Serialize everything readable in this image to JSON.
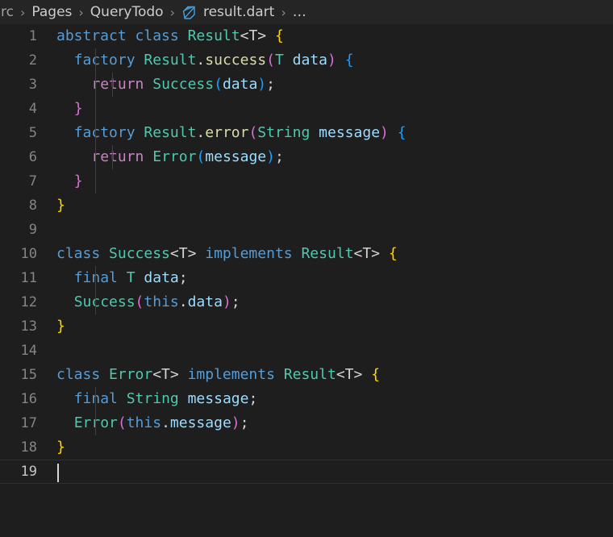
{
  "window": {
    "background": "#1e1e1e",
    "breadcrumb_background": "#252526"
  },
  "breadcrumb": {
    "separator": "›",
    "items": [
      {
        "label": "rc",
        "icon": null
      },
      {
        "label": "Pages",
        "icon": null
      },
      {
        "label": "QueryTodo",
        "icon": null
      },
      {
        "label": "result.dart",
        "icon": "dart-file-icon"
      },
      {
        "label": "…",
        "icon": null
      }
    ]
  },
  "editor": {
    "language": "dart",
    "file_name": "result.dart",
    "cursor_line": 19,
    "cursor_column": 1,
    "line_count": 19,
    "colors": {
      "keyword": "#569cd6",
      "type": "#4ec9b0",
      "control": "#c586c0",
      "function": "#dcdcaa",
      "variable": "#9cdcfe",
      "plain": "#d4d4d4",
      "bracket_yellow": "#ffd700",
      "bracket_violet": "#da70d6",
      "bracket_blue": "#179fff",
      "line_number": "#858585",
      "line_number_active": "#c6c6c6",
      "indent_guide": "#404040",
      "caret": "#d4d4d4"
    },
    "lines": [
      {
        "n": "1",
        "guides": [],
        "text": "abstract class Result<T> {"
      },
      {
        "n": "2",
        "guides": [
          1
        ],
        "text": "  factory Result.success(T data) {"
      },
      {
        "n": "3",
        "guides": [
          1,
          2
        ],
        "text": "    return Success(data);"
      },
      {
        "n": "4",
        "guides": [
          1
        ],
        "text": "  }"
      },
      {
        "n": "5",
        "guides": [
          1
        ],
        "text": "  factory Result.error(String message) {"
      },
      {
        "n": "6",
        "guides": [
          1,
          2
        ],
        "text": "    return Error(message);"
      },
      {
        "n": "7",
        "guides": [
          1
        ],
        "text": "  }"
      },
      {
        "n": "8",
        "guides": [],
        "text": "}"
      },
      {
        "n": "9",
        "guides": [],
        "text": ""
      },
      {
        "n": "10",
        "guides": [],
        "text": "class Success<T> implements Result<T> {"
      },
      {
        "n": "11",
        "guides": [
          1
        ],
        "text": "  final T data;"
      },
      {
        "n": "12",
        "guides": [
          1
        ],
        "text": "  Success(this.data);"
      },
      {
        "n": "13",
        "guides": [],
        "text": "}"
      },
      {
        "n": "14",
        "guides": [],
        "text": ""
      },
      {
        "n": "15",
        "guides": [],
        "text": "class Error<T> implements Result<T> {"
      },
      {
        "n": "16",
        "guides": [
          1
        ],
        "text": "  final String message;"
      },
      {
        "n": "17",
        "guides": [
          1
        ],
        "text": "  Error(this.message);"
      },
      {
        "n": "18",
        "guides": [],
        "text": "}"
      },
      {
        "n": "19",
        "guides": [],
        "text": ""
      }
    ],
    "tokens": [
      [
        {
          "t": "abstract",
          "c": "kw"
        },
        {
          "t": " ",
          "c": "pl"
        },
        {
          "t": "class",
          "c": "kw"
        },
        {
          "t": " ",
          "c": "pl"
        },
        {
          "t": "Result",
          "c": "typ"
        },
        {
          "t": "<T>",
          "c": "pl"
        },
        {
          "t": " ",
          "c": "pl"
        },
        {
          "t": "{",
          "c": "by"
        }
      ],
      [
        {
          "t": "  ",
          "c": "pl"
        },
        {
          "t": "factory",
          "c": "kw"
        },
        {
          "t": " ",
          "c": "pl"
        },
        {
          "t": "Result",
          "c": "typ"
        },
        {
          "t": ".",
          "c": "pl"
        },
        {
          "t": "success",
          "c": "fn"
        },
        {
          "t": "(",
          "c": "bp"
        },
        {
          "t": "T",
          "c": "typ"
        },
        {
          "t": " ",
          "c": "pl"
        },
        {
          "t": "data",
          "c": "var"
        },
        {
          "t": ")",
          "c": "bp"
        },
        {
          "t": " ",
          "c": "pl"
        },
        {
          "t": "{",
          "c": "bb"
        }
      ],
      [
        {
          "t": "    ",
          "c": "pl"
        },
        {
          "t": "return",
          "c": "ctl"
        },
        {
          "t": " ",
          "c": "pl"
        },
        {
          "t": "Success",
          "c": "typ"
        },
        {
          "t": "(",
          "c": "bb"
        },
        {
          "t": "data",
          "c": "var"
        },
        {
          "t": ")",
          "c": "bb"
        },
        {
          "t": ";",
          "c": "pl"
        }
      ],
      [
        {
          "t": "  ",
          "c": "pl"
        },
        {
          "t": "}",
          "c": "bp"
        }
      ],
      [
        {
          "t": "  ",
          "c": "pl"
        },
        {
          "t": "factory",
          "c": "kw"
        },
        {
          "t": " ",
          "c": "pl"
        },
        {
          "t": "Result",
          "c": "typ"
        },
        {
          "t": ".",
          "c": "pl"
        },
        {
          "t": "error",
          "c": "fn"
        },
        {
          "t": "(",
          "c": "bp"
        },
        {
          "t": "String",
          "c": "typ"
        },
        {
          "t": " ",
          "c": "pl"
        },
        {
          "t": "message",
          "c": "var"
        },
        {
          "t": ")",
          "c": "bp"
        },
        {
          "t": " ",
          "c": "pl"
        },
        {
          "t": "{",
          "c": "bb"
        }
      ],
      [
        {
          "t": "    ",
          "c": "pl"
        },
        {
          "t": "return",
          "c": "ctl"
        },
        {
          "t": " ",
          "c": "pl"
        },
        {
          "t": "Error",
          "c": "typ"
        },
        {
          "t": "(",
          "c": "bb"
        },
        {
          "t": "message",
          "c": "var"
        },
        {
          "t": ")",
          "c": "bb"
        },
        {
          "t": ";",
          "c": "pl"
        }
      ],
      [
        {
          "t": "  ",
          "c": "pl"
        },
        {
          "t": "}",
          "c": "bp"
        }
      ],
      [
        {
          "t": "}",
          "c": "by"
        }
      ],
      [],
      [
        {
          "t": "class",
          "c": "kw"
        },
        {
          "t": " ",
          "c": "pl"
        },
        {
          "t": "Success",
          "c": "typ"
        },
        {
          "t": "<T>",
          "c": "pl"
        },
        {
          "t": " ",
          "c": "pl"
        },
        {
          "t": "implements",
          "c": "kw"
        },
        {
          "t": " ",
          "c": "pl"
        },
        {
          "t": "Result",
          "c": "typ"
        },
        {
          "t": "<T>",
          "c": "pl"
        },
        {
          "t": " ",
          "c": "pl"
        },
        {
          "t": "{",
          "c": "by"
        }
      ],
      [
        {
          "t": "  ",
          "c": "pl"
        },
        {
          "t": "final",
          "c": "kw"
        },
        {
          "t": " ",
          "c": "pl"
        },
        {
          "t": "T",
          "c": "typ"
        },
        {
          "t": " ",
          "c": "pl"
        },
        {
          "t": "data",
          "c": "var"
        },
        {
          "t": ";",
          "c": "pl"
        }
      ],
      [
        {
          "t": "  ",
          "c": "pl"
        },
        {
          "t": "Success",
          "c": "typ"
        },
        {
          "t": "(",
          "c": "bp"
        },
        {
          "t": "this",
          "c": "kw"
        },
        {
          "t": ".",
          "c": "pl"
        },
        {
          "t": "data",
          "c": "var"
        },
        {
          "t": ")",
          "c": "bp"
        },
        {
          "t": ";",
          "c": "pl"
        }
      ],
      [
        {
          "t": "}",
          "c": "by"
        }
      ],
      [],
      [
        {
          "t": "class",
          "c": "kw"
        },
        {
          "t": " ",
          "c": "pl"
        },
        {
          "t": "Error",
          "c": "typ"
        },
        {
          "t": "<T>",
          "c": "pl"
        },
        {
          "t": " ",
          "c": "pl"
        },
        {
          "t": "implements",
          "c": "kw"
        },
        {
          "t": " ",
          "c": "pl"
        },
        {
          "t": "Result",
          "c": "typ"
        },
        {
          "t": "<T>",
          "c": "pl"
        },
        {
          "t": " ",
          "c": "pl"
        },
        {
          "t": "{",
          "c": "by"
        }
      ],
      [
        {
          "t": "  ",
          "c": "pl"
        },
        {
          "t": "final",
          "c": "kw"
        },
        {
          "t": " ",
          "c": "pl"
        },
        {
          "t": "String",
          "c": "typ"
        },
        {
          "t": " ",
          "c": "pl"
        },
        {
          "t": "message",
          "c": "var"
        },
        {
          "t": ";",
          "c": "pl"
        }
      ],
      [
        {
          "t": "  ",
          "c": "pl"
        },
        {
          "t": "Error",
          "c": "typ"
        },
        {
          "t": "(",
          "c": "bp"
        },
        {
          "t": "this",
          "c": "kw"
        },
        {
          "t": ".",
          "c": "pl"
        },
        {
          "t": "message",
          "c": "var"
        },
        {
          "t": ")",
          "c": "bp"
        },
        {
          "t": ";",
          "c": "pl"
        }
      ],
      [
        {
          "t": "}",
          "c": "by"
        }
      ],
      []
    ]
  }
}
